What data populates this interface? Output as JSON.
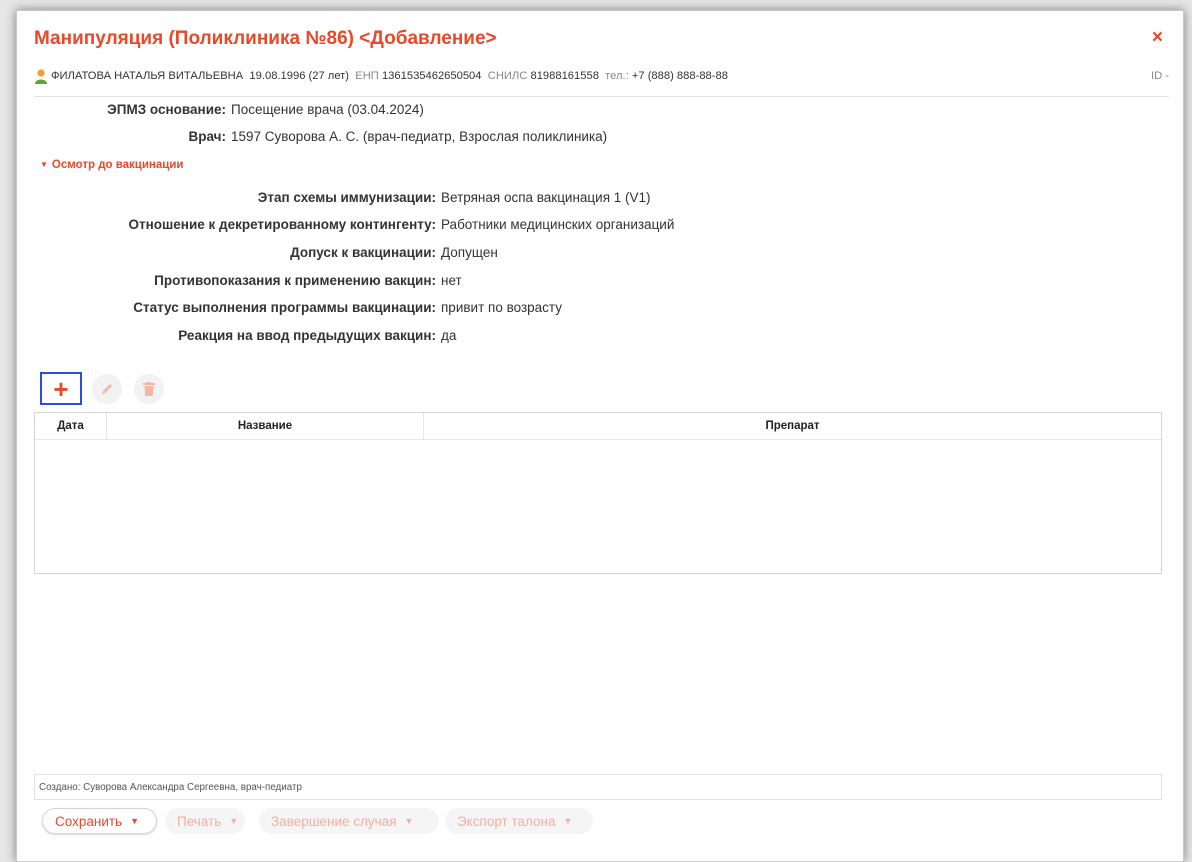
{
  "dialog": {
    "title": "Манипуляция (Поликлиника №86) <Добавление>",
    "close_glyph": "×"
  },
  "patient": {
    "icon": "person-icon",
    "name": "ФИЛАТОВА НАТАЛЬЯ ВИТАЛЬЕВНА",
    "birth": "19.08.1996 (27 лет)",
    "enp_label": "ЕНП",
    "enp_value": "1361535462650504",
    "snils_label": "СНИЛС",
    "snils_value": "81988161558",
    "phone_label": "тел.:",
    "phone_value": "+7 (888) 888-88-88",
    "id_label": "ID -"
  },
  "fields": {
    "epmz_label": "ЭПМЗ основание:",
    "epmz_value": "Посещение врача (03.04.2024)",
    "doctor_label": "Врач:",
    "doctor_value": "1597 Суворова А. С.  (врач-педиатр, Взрослая поликлиника)"
  },
  "section": {
    "toggle_glyph": "▼",
    "title": "Осмотр до вакцинации"
  },
  "exam": [
    {
      "label": "Этап схемы иммунизации:",
      "value": "Ветряная оспа вакцинация 1 (V1)"
    },
    {
      "label": "Отношение к декретированному контингенту:",
      "value": "Работники медицинских организаций"
    },
    {
      "label": "Допуск к вакцинации:",
      "value": "Допущен"
    },
    {
      "label": "Противопоказания к применению вакцин:",
      "value": "нет"
    },
    {
      "label": "Статус выполнения программы вакцинации:",
      "value": "привит по возрасту"
    },
    {
      "label": "Реакция на ввод предыдущих вакцин:",
      "value": "да"
    }
  ],
  "toolbar": {
    "add_glyph": "+"
  },
  "table": {
    "columns": [
      "Дата",
      "Название",
      "Препарат"
    ],
    "rows": []
  },
  "footer": {
    "created": "Создано: Суворова Александра Сергеевна, врач-педиатр",
    "save": "Сохранить",
    "print": "Печать",
    "finish": "Завершение случая",
    "export": "Экспорт талона",
    "caret": "▼"
  },
  "colors": {
    "accent": "#e8492a",
    "highlight_border": "#2a4ed8"
  }
}
